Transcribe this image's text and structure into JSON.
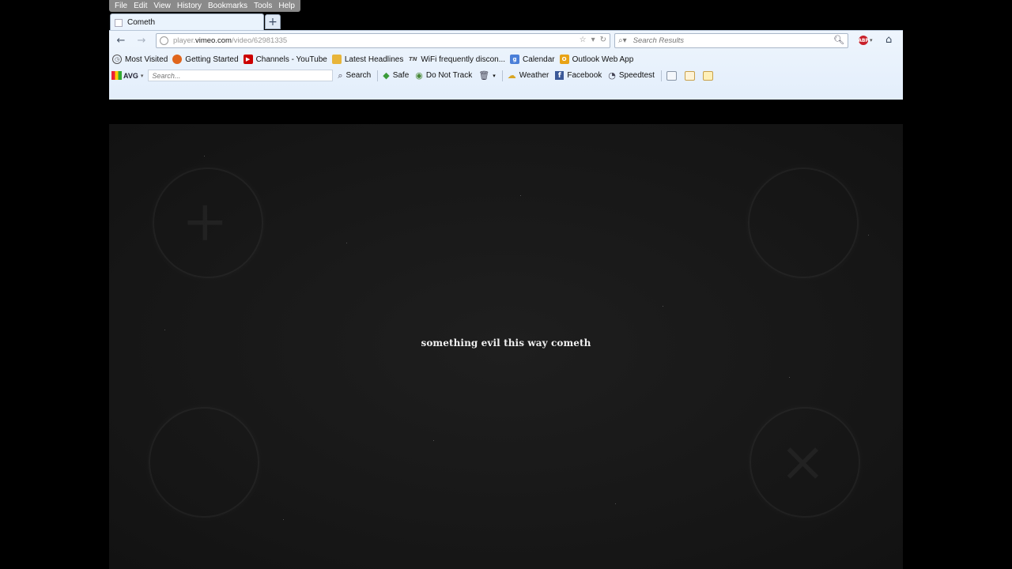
{
  "menu": [
    "File",
    "Edit",
    "View",
    "History",
    "Bookmarks",
    "Tools",
    "Help"
  ],
  "tab": {
    "title": "Cometh",
    "new_tab": "+"
  },
  "nav": {
    "url_prefix": "player.",
    "url_host": "vimeo.com",
    "url_path": "/video/62981335",
    "search_placeholder": "Search Results"
  },
  "bookmarks": [
    {
      "label": "Most Visited",
      "icon": "clock-icon",
      "color": "#555555"
    },
    {
      "label": "Getting Started",
      "icon": "firefox-icon",
      "color": "#e0661d"
    },
    {
      "label": "Channels - YouTube",
      "icon": "youtube-icon",
      "color": "#cc0000"
    },
    {
      "label": "Latest Headlines",
      "icon": "rss-folder-icon",
      "color": "#e8b53a"
    },
    {
      "label": "WiFi frequently discon...",
      "icon": "tn-icon",
      "color": "#666666"
    },
    {
      "label": "Calendar",
      "icon": "google-icon",
      "color": "#4a7fd8"
    },
    {
      "label": "Outlook Web App",
      "icon": "outlook-icon",
      "color": "#e8a317"
    }
  ],
  "avg": {
    "logo": "AVG",
    "search_placeholder": "Search...",
    "search_label": "Search",
    "safe_label": "Safe",
    "dnt_label": "Do Not Track",
    "weather_label": "Weather",
    "facebook_label": "Facebook",
    "speedtest_label": "Speedtest"
  },
  "video": {
    "caption": "something evil this way cometh"
  }
}
